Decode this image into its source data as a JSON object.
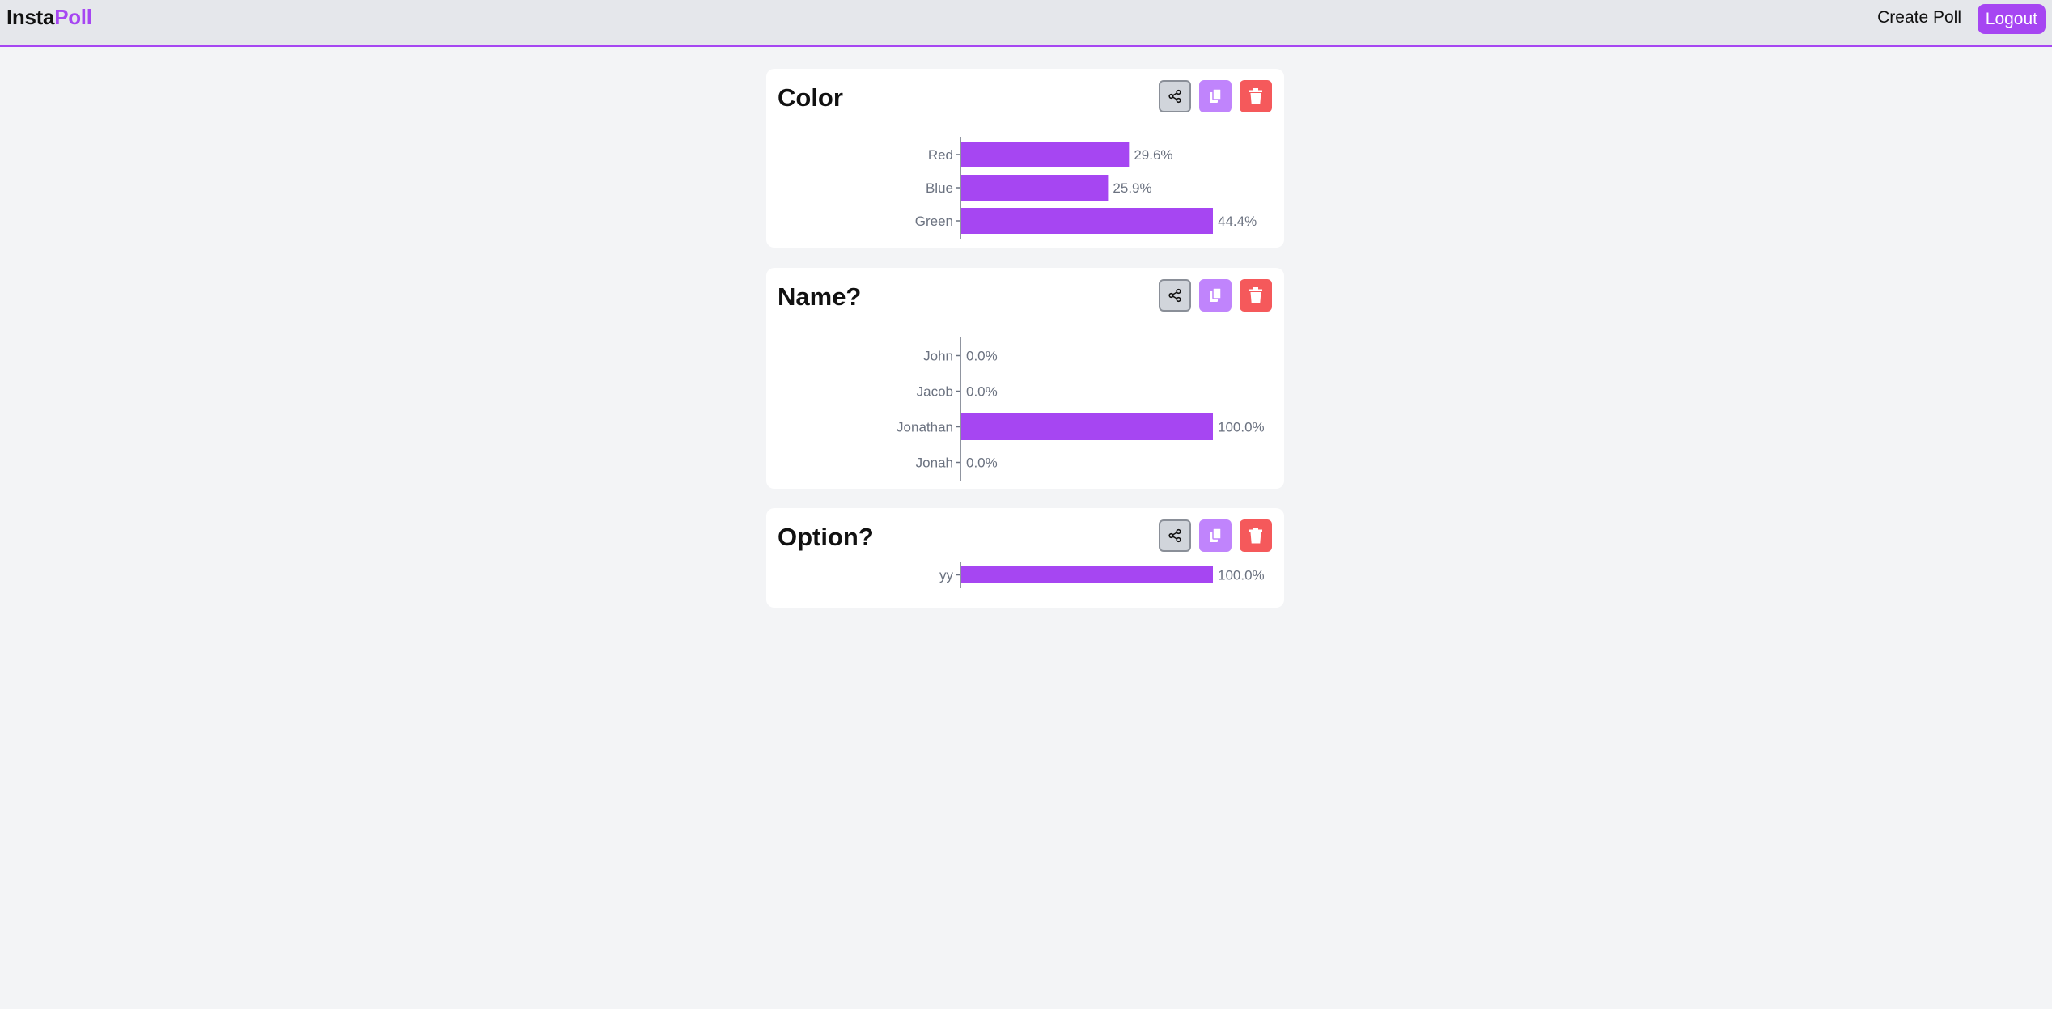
{
  "navbar": {
    "logo_part1": "Insta",
    "logo_part2": "Poll",
    "create_poll_label": "Create Poll",
    "logout_label": "Logout"
  },
  "colors": {
    "accent": "#a646f2",
    "bar": "#a646f2",
    "copy_button": "#c084fc",
    "delete_button": "#f5595b",
    "share_button": "#d1d5db"
  },
  "icons": {
    "share": "share-icon",
    "copy": "copy-icon",
    "delete": "trash-icon"
  },
  "polls": [
    {
      "title": "Color",
      "chart_data": {
        "type": "bar",
        "orientation": "horizontal",
        "categories": [
          "Red",
          "Blue",
          "Green"
        ],
        "values": [
          29.6,
          25.9,
          44.4
        ],
        "value_labels": [
          "29.6%",
          "25.9%",
          "44.4%"
        ],
        "xlim": [
          0,
          44.4
        ]
      }
    },
    {
      "title": "Name?",
      "chart_data": {
        "type": "bar",
        "orientation": "horizontal",
        "categories": [
          "John",
          "Jacob",
          "Jonathan",
          "Jonah"
        ],
        "values": [
          0.0,
          0.0,
          100.0,
          0.0
        ],
        "value_labels": [
          "0.0%",
          "0.0%",
          "100.0%",
          "0.0%"
        ],
        "xlim": [
          0,
          100
        ]
      }
    },
    {
      "title": "Option?",
      "chart_data": {
        "type": "bar",
        "orientation": "horizontal",
        "categories": [
          "yy"
        ],
        "values": [
          100.0
        ],
        "value_labels": [
          "100.0%"
        ],
        "xlim": [
          0,
          100
        ]
      }
    }
  ]
}
